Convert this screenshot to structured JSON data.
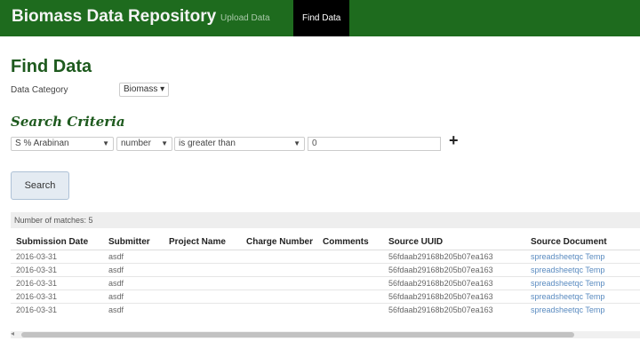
{
  "navbar": {
    "brand": "Biomass Data Repository",
    "links": [
      "Upload Data",
      "Find Data"
    ],
    "active": "Find Data",
    "color": "#1e6b1e"
  },
  "page": {
    "title": "Find Data",
    "category_label": "Data Category",
    "category_value": "Biomass ▾"
  },
  "search": {
    "title": "Search Criteria",
    "field": "S % Arabinan",
    "type": "number",
    "operator": "is greater than",
    "value": "0",
    "add_icon": "plus-icon",
    "button_label": "Search"
  },
  "results": {
    "matches_text": "Number of matches: 5",
    "columns": [
      "Submission Date",
      "Submitter",
      "Project Name",
      "Charge Number",
      "Comments",
      "Source UUID",
      "Source Document"
    ],
    "rows": [
      [
        "2016-03-31",
        "asdf",
        "",
        "",
        "",
        "56fdaab29168b205b07ea163",
        "spreadsheetqc Temp"
      ],
      [
        "2016-03-31",
        "asdf",
        "",
        "",
        "",
        "56fdaab29168b205b07ea163",
        "spreadsheetqc Temp"
      ],
      [
        "2016-03-31",
        "asdf",
        "",
        "",
        "",
        "56fdaab29168b205b07ea163",
        "spreadsheetqc Temp"
      ],
      [
        "2016-03-31",
        "asdf",
        "",
        "",
        "",
        "56fdaab29168b205b07ea163",
        "spreadsheetqc Temp"
      ],
      [
        "2016-03-31",
        "asdf",
        "",
        "",
        "",
        "56fdaab29168b205b07ea163",
        "spreadsheetqc Temp"
      ]
    ]
  }
}
